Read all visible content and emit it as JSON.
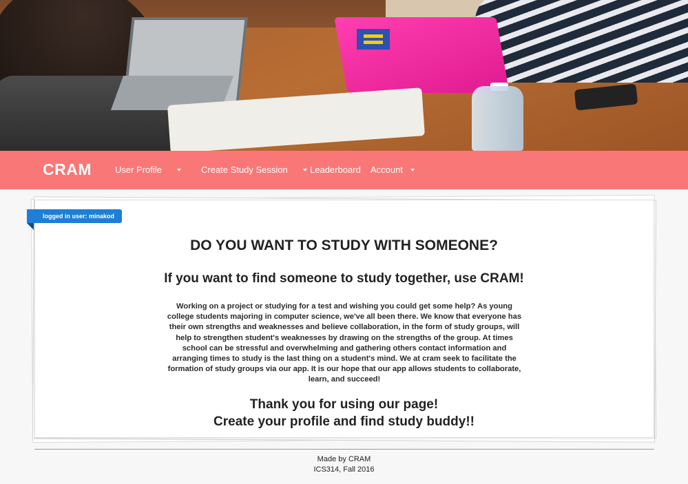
{
  "navbar": {
    "brand": "CRAM",
    "items": [
      {
        "label": "User Profile",
        "dropdown": true
      },
      {
        "label": "Create Study Session",
        "dropdown": true
      },
      {
        "label": "Leaderboard",
        "dropdown": false
      },
      {
        "label": "Account",
        "dropdown": true
      }
    ],
    "color": "#f97777"
  },
  "ribbon": {
    "text": "logged in user: minakod",
    "color": "#1d7fd6"
  },
  "main": {
    "heading": "DO YOU WANT TO STUDY WITH SOMEONE?",
    "subheading": "If you want to find someone to study together, use CRAM!",
    "paragraph": "Working on a project or studying for a test and wishing you could get some help? As young college students majoring in computer science, we've all been there. We know that everyone has their own strengths and weaknesses and believe collaboration, in the form of study groups, will help to strengthen student's weaknesses by drawing on the strengths of the group. At times school can be stressful and overwhelming and gathering others contact information and arranging times to study is the last thing on a student's mind. We at cram seek to facilitate the formation of study groups via our app. It is our hope that our app allows students to collaborate, learn, and succeed!",
    "thanks_line1": "Thank you for using our page!",
    "thanks_line2": "Create your profile and find study buddy!!"
  },
  "footer": {
    "line1": "Made by CRAM",
    "line2": "ICS314, Fall 2016"
  }
}
